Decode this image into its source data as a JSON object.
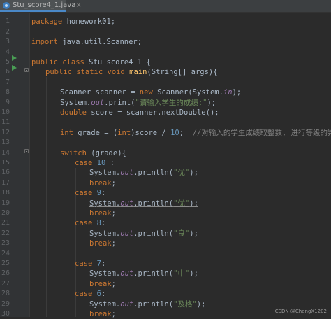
{
  "tab": {
    "filename": "Stu_score4_1.java",
    "close": "×",
    "icon": "java-file-icon"
  },
  "line_numbers": [
    "1",
    "2",
    "3",
    "4",
    "5",
    "6",
    "7",
    "8",
    "9",
    "10",
    "11",
    "12",
    "13",
    "14",
    "15",
    "16",
    "17",
    "18",
    "19",
    "20",
    "21",
    "22",
    "23",
    "24",
    "25",
    "26",
    "27",
    "28",
    "29",
    "30"
  ],
  "code": {
    "l1_a": "package",
    "l1_b": " homework01;",
    "l3_a": "import",
    "l3_b": " java.util.Scanner;",
    "l5_a": "public class",
    "l5_b": " Stu_score4_1 {",
    "l6_a": "public static void",
    "l6_b": "main",
    "l6_c": "(String[] args){",
    "l8_a": "Scanner scanner = ",
    "l8_b": "new",
    "l8_c": " Scanner(System.",
    "l8_d": "in",
    "l8_e": ");",
    "l9_a": "System.",
    "l9_b": "out",
    "l9_c": ".print(",
    "l9_d": "\"请输入学生的成绩:\"",
    "l9_e": ");",
    "l10_a": "double",
    "l10_b": " score = scanner.nextDouble();",
    "l12_a": "int",
    "l12_b": " grade = (",
    "l12_c": "int",
    "l12_d": ")score / ",
    "l12_e": "10",
    "l12_f": ";  ",
    "l12_g": "//对输入的学生成绩取整数, 进行等级的判断",
    "l14_a": "switch",
    "l14_b": " (grade){",
    "l15_a": "case",
    "l15_b": " 10",
    "l15_c": " :",
    "l16_a": "System.",
    "l16_b": "out",
    "l16_c": ".println(",
    "l16_d": "\"优\"",
    "l16_e": ");",
    "l17_a": "break",
    "l17_b": ";",
    "l18_a": "case",
    "l18_b": " 9",
    "l18_c": ":",
    "l19_a": "System.",
    "l19_b": "out",
    "l19_c": ".println(",
    "l19_d": "\"优\"",
    "l19_e": ");",
    "l20_a": "break",
    "l20_b": ";",
    "l21_a": "case",
    "l21_b": " 8",
    "l21_c": ":",
    "l22_a": "System.",
    "l22_b": "out",
    "l22_c": ".println(",
    "l22_d": "\"良\"",
    "l22_e": ");",
    "l23_a": "break",
    "l23_b": ";",
    "l25_a": "case",
    "l25_b": " 7",
    "l25_c": ":",
    "l26_a": "System.",
    "l26_b": "out",
    "l26_c": ".println(",
    "l26_d": "\"中\"",
    "l26_e": ");",
    "l27_a": "break",
    "l27_b": ";",
    "l28_a": "case",
    "l28_b": " 6",
    "l28_c": ":",
    "l29_a": "System.",
    "l29_b": "out",
    "l29_c": ".println(",
    "l29_d": "\"及格\"",
    "l29_e": ");",
    "l30_a": "break",
    "l30_b": ";"
  },
  "watermark": "CSDN @ChengX1202",
  "colors": {
    "background": "#2b2b2b",
    "keyword": "#cc7832",
    "number": "#6897bb",
    "string": "#6a8759",
    "field": "#9876aa",
    "method": "#ffc66d",
    "comment": "#808080"
  }
}
